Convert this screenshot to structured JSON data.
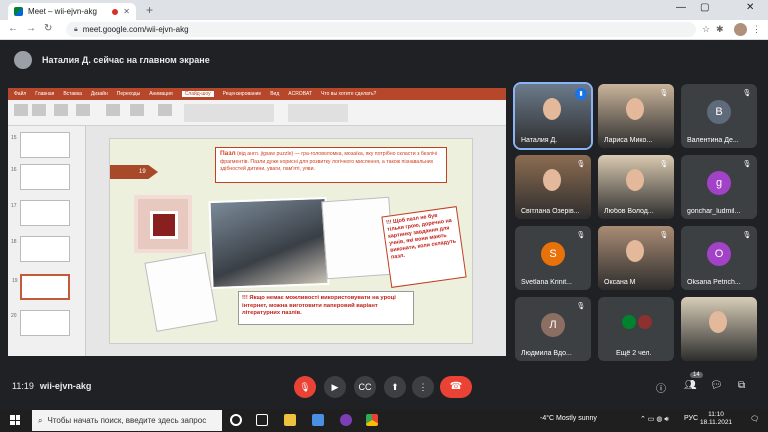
{
  "browser": {
    "tab_title": "Meet – wii-ejvn-akg",
    "url": "meet.google.com/wii-ejvn-akg",
    "new_tab": "+",
    "close": "✕"
  },
  "meet": {
    "presenter_text": "Наталия Д. сейчас на главном экране",
    "time": "11:19",
    "code": "wii-ejvn-akg",
    "participants_count": "14"
  },
  "slide": {
    "number": "19",
    "definition_title": "Пазл",
    "definition_text": "(від англ. jigsaw puzzle) — гра-головоломка, мозаїка, яку потрібно скласти з безлічі фрагментів. Пазли дуже корисні для розвитку логічного мислення, а також пізнавальних здібностей дитини, уваги, пам'яті, уяви.",
    "note_text": "!!! Щоб пазл не був тільки грою, доречно на картинку завдання для учнів, які вони мають виконати, коли складуть пазл.",
    "bottom_text": "!!! Якщо немає можливості використовувати на уроці інтернет, можна виготовити паперовий варіант літературних пазлів."
  },
  "ppt": {
    "tabs": [
      "Файл",
      "Главная",
      "Вставка",
      "Дизайн",
      "Переходы",
      "Анимация",
      "Слайд-шоу",
      "Рецензирование",
      "Вид",
      "ACROBAT",
      "Что вы хотите сделать?"
    ]
  },
  "tiles": [
    {
      "name": "Наталия Д.",
      "type": "camera",
      "speaking": true
    },
    {
      "name": "Лариса Мико...",
      "type": "camera"
    },
    {
      "name": "Валентина Де...",
      "type": "avatar",
      "letter": "В",
      "color": "#5f6b7a"
    },
    {
      "name": "Світлана Озерів...",
      "type": "camera"
    },
    {
      "name": "Любов Волод...",
      "type": "camera"
    },
    {
      "name": "gonchar_ludmil...",
      "type": "avatar",
      "letter": "g",
      "color": "#a142c7"
    },
    {
      "name": "Svetlana Krinit...",
      "type": "avatar",
      "letter": "S",
      "color": "#e8710a"
    },
    {
      "name": "Оксана М",
      "type": "camera"
    },
    {
      "name": "Oksana Petrich...",
      "type": "avatar",
      "letter": "O",
      "color": "#a142c7"
    },
    {
      "name": "Людмила Вдо...",
      "type": "avatar",
      "letter": "Л",
      "color": "#8d6e63"
    },
    {
      "name": "Ещё 2 чел.",
      "type": "extra"
    },
    {
      "name": "",
      "type": "camera"
    }
  ],
  "taskbar": {
    "search_placeholder": "Чтобы начать поиск, введите здесь запрос",
    "weather": "-4°C  Mostly sunny",
    "lang": "РУС",
    "time": "11:10",
    "date": "18.11.2021"
  },
  "colors": {
    "meet_bg": "#202124",
    "accent_red": "#ea4335",
    "ppt_red": "#b7472a"
  }
}
